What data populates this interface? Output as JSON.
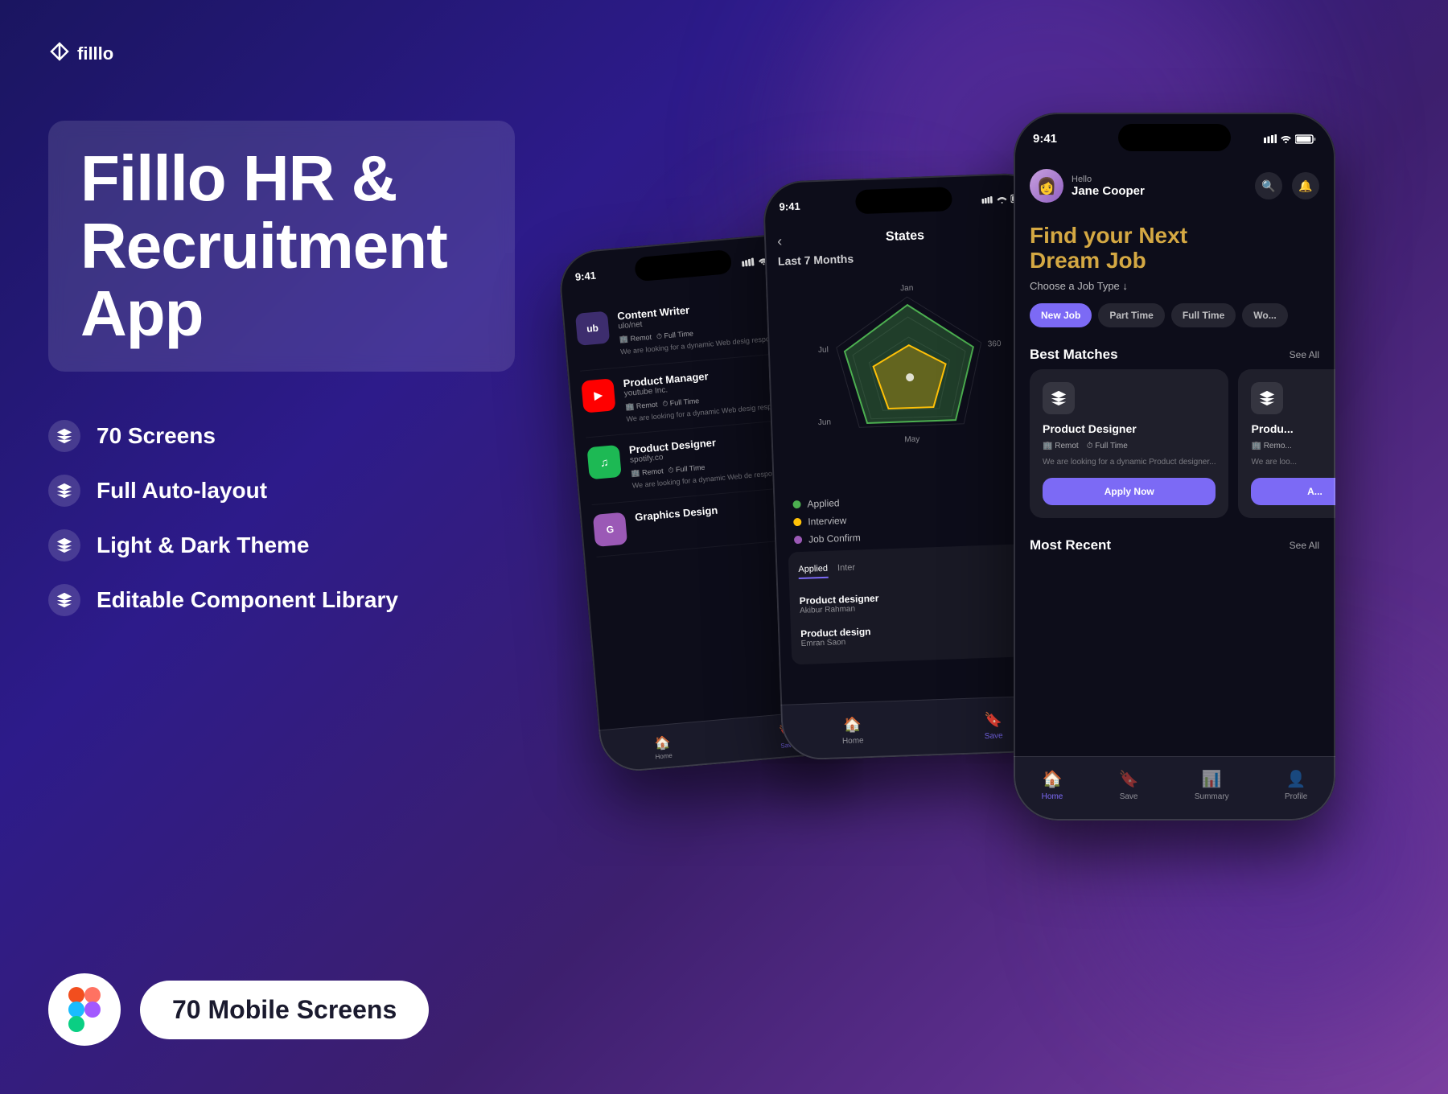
{
  "brand": {
    "name": "filllo",
    "logo_symbol": "⚡"
  },
  "hero": {
    "title_line1": "Filllo HR &",
    "title_line2": "Recruitment App"
  },
  "features": [
    {
      "id": "screens",
      "text": "70 Screens"
    },
    {
      "id": "layout",
      "text": "Full Auto-layout"
    },
    {
      "id": "theme",
      "text": "Light & Dark Theme"
    },
    {
      "id": "library",
      "text": "Editable Component Library"
    }
  ],
  "badges": {
    "screens_count": "70 Mobile Screens"
  },
  "phone_left": {
    "jobs": [
      {
        "title": "Content Writer",
        "company": "ulo/net",
        "logo_color": "#E85D4A",
        "logo_text": "ub",
        "tags": [
          "Remot",
          "Full Time"
        ],
        "desc": "We are looking for a dynamic Web desig responsible..."
      },
      {
        "title": "Product Manager",
        "company": "youtube Inc.",
        "logo_color": "#FF0000",
        "logo_text": "▶",
        "tags": [
          "Remot",
          "Full Time"
        ],
        "desc": "We are looking for a dynamic Web desig responsible..."
      },
      {
        "title": "Product Designer",
        "company": "spotify.co",
        "logo_color": "#1DB954",
        "logo_text": "♫",
        "tags": [
          "Remot",
          "Full Time"
        ],
        "desc": "We are looking for a dynamic Web de responsible..."
      },
      {
        "title": "Graphics Design",
        "company": "",
        "logo_color": "#9B59B6",
        "logo_text": "G",
        "tags": [],
        "desc": ""
      }
    ]
  },
  "phone_middle": {
    "title": "States",
    "period": "Last 7 Months",
    "months": [
      "Jan",
      "Jul",
      "Jun",
      "May"
    ],
    "legend": [
      {
        "color": "#4CAF50",
        "label": "Applied"
      },
      {
        "color": "#FFC107",
        "label": "Interview"
      },
      {
        "color": "#9B59B6",
        "label": "Job Confirm"
      }
    ],
    "applied_tabs": [
      "Applied",
      "Inter"
    ],
    "applied_jobs": [
      {
        "title": "Product designer",
        "company": "Akibur Rahman"
      },
      {
        "title": "Product design",
        "company": "Emran Saon"
      }
    ]
  },
  "phone_right": {
    "time": "9:41",
    "hello": "Hello",
    "user_name": "Jane Cooper",
    "dream_title_line1": "Find your Next",
    "dream_title_line2": "Dream Job",
    "choose_type": "Choose a Job Type ↓",
    "job_types": [
      {
        "label": "New Job",
        "active": true
      },
      {
        "label": "Part Time",
        "active": false
      },
      {
        "label": "Full Time",
        "active": false
      },
      {
        "label": "Wo...",
        "active": false
      }
    ],
    "best_matches_title": "Best Matches",
    "see_all": "See All",
    "cards": [
      {
        "title": "Product Designer",
        "tags": [
          "Remot",
          "Full Time"
        ],
        "desc": "We are looking for a dynamic Product designer...",
        "apply_label": "Apply Now"
      },
      {
        "title": "Produ...",
        "tags": [
          "Remo...",
          ""
        ],
        "desc": "We are loo...",
        "apply_label": "A..."
      }
    ],
    "most_recent_title": "Most Recent",
    "tab_bar": [
      {
        "icon": "🏠",
        "label": "Home",
        "active": true
      },
      {
        "icon": "🔖",
        "label": "Save",
        "active": false
      },
      {
        "icon": "📊",
        "label": "Summary",
        "active": false
      },
      {
        "icon": "👤",
        "label": "Profile",
        "active": false
      }
    ]
  },
  "colors": {
    "accent_purple": "#7c6af5",
    "accent_gold": "#d4a843",
    "bg_dark": "#0d0d1a",
    "bg_card": "rgba(255,255,255,0.08)",
    "applied_green": "#4CAF50",
    "interview_yellow": "#FFC107",
    "confirm_purple": "#9B59B6"
  }
}
